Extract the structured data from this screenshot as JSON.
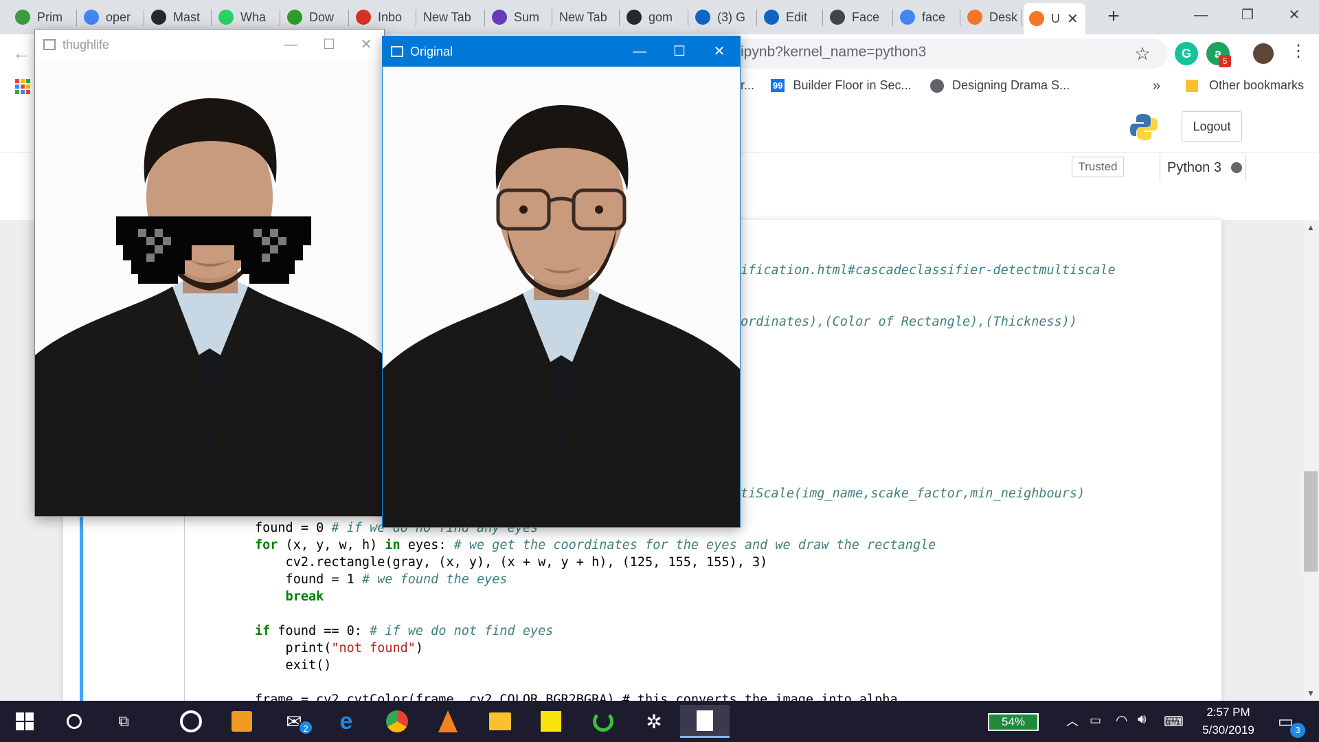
{
  "browser": {
    "tabs": [
      {
        "label": "Prim",
        "icon": "play-icon",
        "color": "#3c9b3c"
      },
      {
        "label": "oper",
        "icon": "google-icon",
        "color": "#4285f4"
      },
      {
        "label": "Mast",
        "icon": "github-icon",
        "color": "#24292e"
      },
      {
        "label": "Wha",
        "icon": "whatsapp-icon",
        "color": "#25d366"
      },
      {
        "label": "Dow",
        "icon": "ftu-icon",
        "color": "#2a9d2a"
      },
      {
        "label": "Inbo",
        "icon": "gmail-icon",
        "color": "#d93025"
      },
      {
        "label": "New Tab",
        "icon": "",
        "color": ""
      },
      {
        "label": "Sum",
        "icon": "forms-icon",
        "color": "#673ab7"
      },
      {
        "label": "New Tab",
        "icon": "",
        "color": ""
      },
      {
        "label": "gom",
        "icon": "github-icon",
        "color": "#24292e"
      },
      {
        "label": "(3) G",
        "icon": "linkedin-icon",
        "color": "#0a66c2"
      },
      {
        "label": "Edit",
        "icon": "linkedin-icon",
        "color": "#0a66c2"
      },
      {
        "label": "Face",
        "icon": "book-icon",
        "color": "#444444"
      },
      {
        "label": "face",
        "icon": "google-icon",
        "color": "#4285f4"
      },
      {
        "label": "Desk",
        "icon": "loading-icon",
        "color": "#f37726"
      },
      {
        "label": "U",
        "icon": "hourglass-icon",
        "color": "#f37726"
      }
    ],
    "url": "ipynb?kernel_name=python3",
    "bookmarks": {
      "truncated": "r...",
      "item1": "Builder Floor in Sec...",
      "item1_badge": "99",
      "item2": "Designing Drama S...",
      "overflow": "»",
      "other": "Other bookmarks"
    },
    "extension_badge": "5"
  },
  "jupyter": {
    "logout": "Logout",
    "trusted": "Trusted",
    "kernel": "Python 3",
    "code": {
      "line1": "ification.html#cascadeclassifier-detectmultiscale",
      "line2": "ordinates),(Color of Rectangle),(Thickness))",
      "line3": "tiScale(img_name,scake_factor,min_neighbours)",
      "line4_code": "found = 0 ",
      "line4_comment": "# if we do no find any eyes",
      "line5_kw": "for",
      "line5_a": " (x, y, w, h) ",
      "line5_kw2": "in",
      "line5_b": " eyes: ",
      "line5_comment": "# we get the coordinates for the eyes and we draw the rectangle",
      "line6": "    cv2.rectangle(gray, (x, y), (x + w, y + h), (125, 155, 155), 3)",
      "line7_code": "    found = 1 ",
      "line7_comment": "# we found the eyes",
      "line8": "    break",
      "line9_kw": "if",
      "line9_code": " found == 0: ",
      "line9_comment": "# if we do not find eyes",
      "line10_a": "    print(",
      "line10_str": "\"not found\"",
      "line10_b": ")",
      "line11": "    exit()",
      "line12": "frame = cv2.cvtColor(frame, cv2.COLOR_BGR2BGRA) # this converts the image into alpha"
    }
  },
  "windows": {
    "thuglife": {
      "title": "thughlife"
    },
    "original": {
      "title": "Original"
    }
  },
  "taskbar": {
    "mail_badge": "2",
    "battery": "54%",
    "time": "2:57 PM",
    "date": "5/30/2019",
    "notification_badge": "3"
  }
}
